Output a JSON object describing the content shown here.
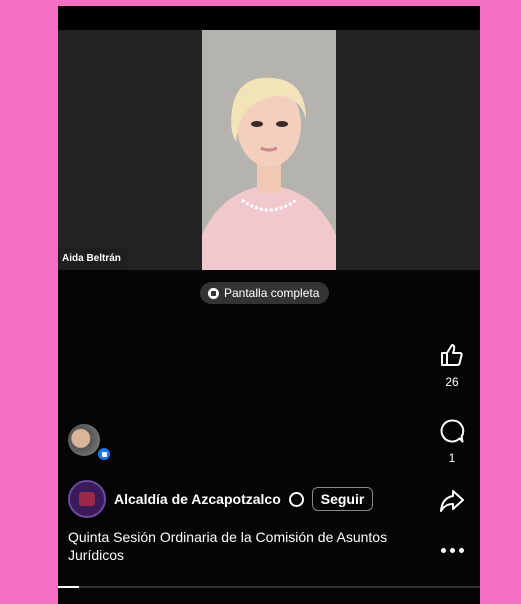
{
  "video": {
    "speaker_name": "Aida Beltrán",
    "fullscreen_label": "Pantalla completa",
    "progress": 0.05
  },
  "actions": {
    "like_count": "26",
    "comment_count": "1"
  },
  "post": {
    "page_name": "Alcaldía de Azcapotzalco",
    "follow_label": "Seguir",
    "caption": "Quinta Sesión Ordinaria de la Comisión de Asuntos Jurídicos"
  },
  "icons": [
    "like-icon",
    "comment-icon",
    "share-icon",
    "more-icon",
    "globe-icon",
    "fullscreen-icon"
  ],
  "colors": {
    "background": "#f26fc5",
    "accent": "#1877f2"
  }
}
